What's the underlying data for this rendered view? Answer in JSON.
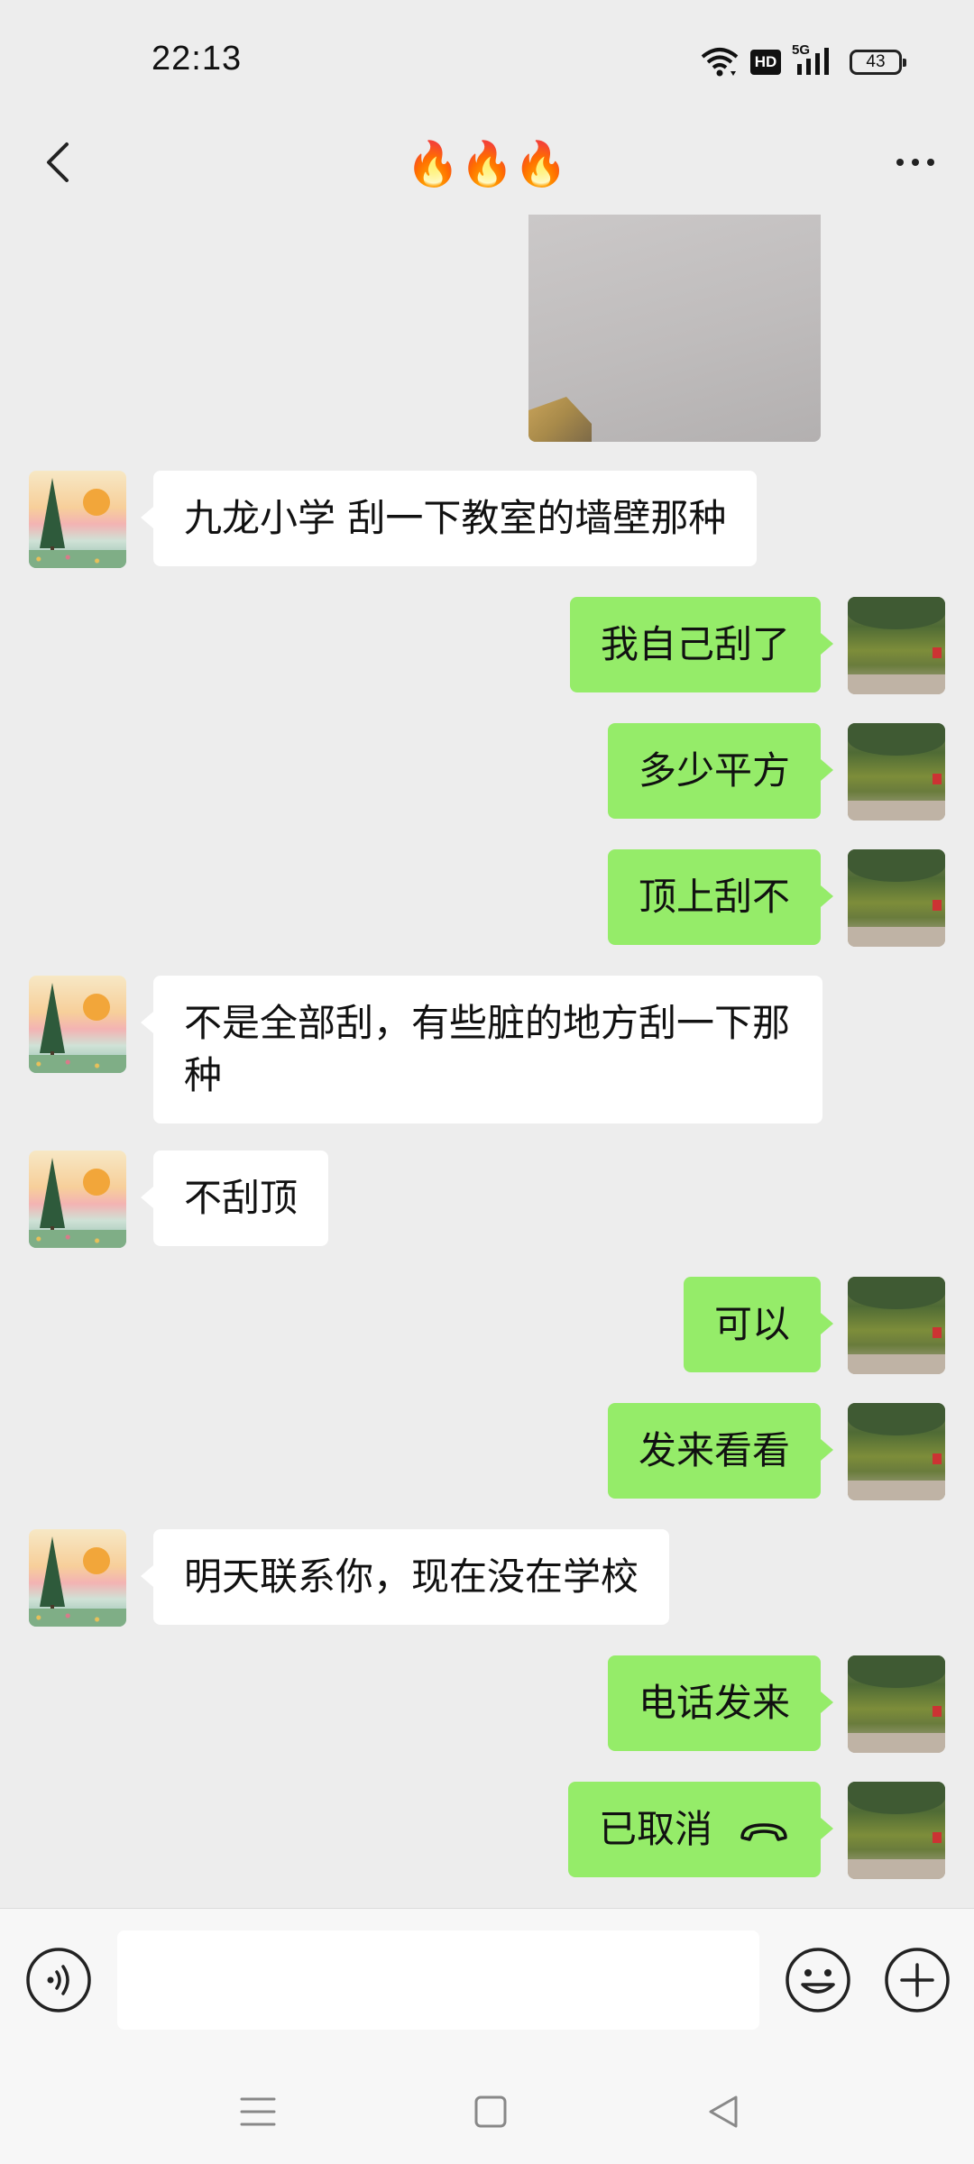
{
  "status_bar": {
    "time": "22:13",
    "hd": "HD",
    "network": "5G",
    "battery": "43"
  },
  "nav": {
    "title": "🔥🔥🔥"
  },
  "messages": [
    {
      "side": "left",
      "text": "九龙小学 刮一下教室的墙壁那种"
    },
    {
      "side": "right",
      "text": "我自己刮了"
    },
    {
      "side": "right",
      "text": "多少平方"
    },
    {
      "side": "right",
      "text": "顶上刮不"
    },
    {
      "side": "left",
      "text": "不是全部刮，有些脏的地方刮一下那种"
    },
    {
      "side": "left",
      "text": "不刮顶"
    },
    {
      "side": "right",
      "text": "可以"
    },
    {
      "side": "right",
      "text": "发来看看"
    },
    {
      "side": "left",
      "text": "明天联系你，现在没在学校"
    },
    {
      "side": "right",
      "text": "电话发来"
    },
    {
      "side": "right",
      "text": "已取消",
      "type": "call",
      "icon": "hangup-icon"
    }
  ],
  "input": {
    "value": "",
    "placeholder": ""
  },
  "icons": {
    "voice": "voice-icon",
    "emoji": "emoji-icon",
    "plus": "plus-icon",
    "back": "back-arrow-icon",
    "more": "more-icon"
  },
  "colors": {
    "background": "#ededed",
    "outgoing_bubble": "#95ec69",
    "incoming_bubble": "#ffffff"
  }
}
